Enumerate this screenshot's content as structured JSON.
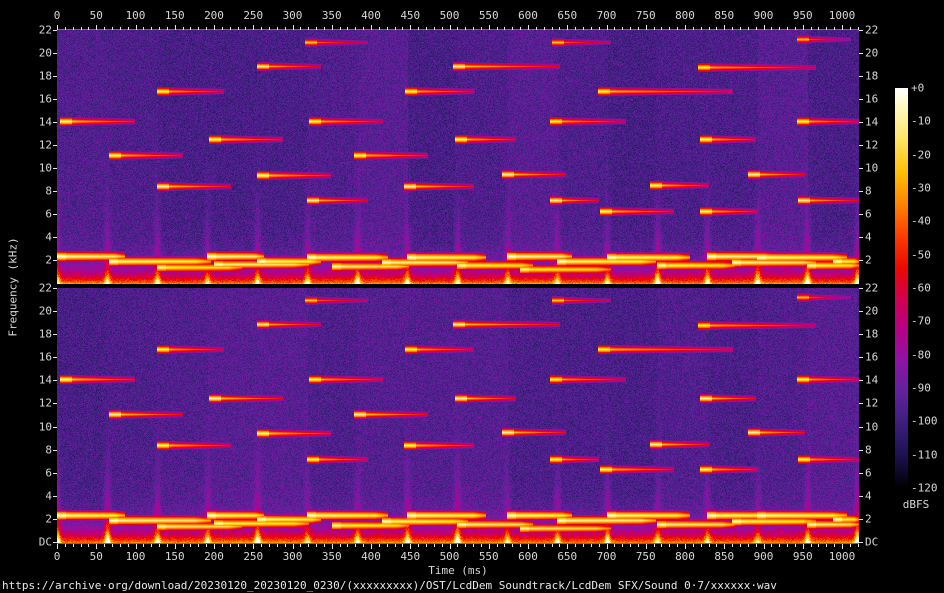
{
  "chart_data": {
    "type": "heatmap",
    "subtype": "stereo_audio_spectrogram",
    "title": "https://archive·org/download/20230120_20230120_0230/(xxxxxxxxx)/OST/LcdDem Soundtrack/LcdDem SFX/Sound 0·7/xxxxxx·wav",
    "xlabel": "Time (ms)",
    "ylabel": "Frequency (kHz)",
    "x_range_ms": [
      0,
      1022
    ],
    "x_ticks_ms": [
      0,
      50,
      100,
      150,
      200,
      250,
      300,
      350,
      400,
      450,
      500,
      550,
      600,
      650,
      700,
      750,
      800,
      850,
      900,
      950,
      1000
    ],
    "x_minor_tick_step_ms": 10,
    "y_range_khz": [
      0,
      22
    ],
    "y_tick_labels": [
      "22",
      "20",
      "18",
      "16",
      "14",
      "12",
      "10",
      "8",
      "6",
      "4",
      "2"
    ],
    "y_dc_label": "DC",
    "channels": [
      "channel-1",
      "channel-2"
    ],
    "legend_position": "right",
    "grid": false,
    "colorbar": {
      "label": "dBFS",
      "tick_labels": [
        "+0",
        "-10",
        "-20",
        "-30",
        "-40",
        "-50",
        "-60",
        "-70",
        "-80",
        "-90",
        "-100",
        "-110",
        "-120"
      ],
      "db_range": [
        0,
        -120
      ],
      "gradient_stops": [
        [
          0.0,
          "#ffffff"
        ],
        [
          0.04,
          "#fff9c8"
        ],
        [
          0.12,
          "#ffe76e"
        ],
        [
          0.21,
          "#ffc005"
        ],
        [
          0.29,
          "#ff8300"
        ],
        [
          0.37,
          "#ff3c00"
        ],
        [
          0.45,
          "#ec0800"
        ],
        [
          0.52,
          "#d4004a"
        ],
        [
          0.6,
          "#b80083"
        ],
        [
          0.68,
          "#8f13a5"
        ],
        [
          0.76,
          "#62219c"
        ],
        [
          0.84,
          "#3c1e7c"
        ],
        [
          0.92,
          "#1c1150"
        ],
        [
          1.0,
          "#000000"
        ]
      ]
    },
    "noise_floor_db": -96,
    "note_interval_ms": 63.7,
    "tone_segments": {
      "columns": [
        "t0_ms",
        "t1_ms",
        "khz",
        "level"
      ],
      "rows": [
        [
          4,
          98,
          14.1,
          0.95
        ],
        [
          66,
          159,
          11.1,
          0.9
        ],
        [
          127,
          212,
          16.7,
          0.85
        ],
        [
          127,
          220,
          8.4,
          0.9
        ],
        [
          194,
          287,
          12.5,
          0.9
        ],
        [
          255,
          335,
          18.9,
          0.8
        ],
        [
          255,
          348,
          9.4,
          0.95
        ],
        [
          316,
          395,
          21.0,
          0.55
        ],
        [
          318,
          395,
          7.2,
          0.85
        ],
        [
          321,
          414,
          14.1,
          0.85
        ],
        [
          378,
          471,
          11.1,
          0.9
        ],
        [
          443,
          530,
          16.7,
          0.85
        ],
        [
          442,
          530,
          8.4,
          0.9
        ],
        [
          505,
          639,
          18.9,
          0.85
        ],
        [
          507,
          583,
          12.5,
          0.9
        ],
        [
          567,
          647,
          9.5,
          0.9
        ],
        [
          628,
          723,
          14.1,
          0.8
        ],
        [
          628,
          689,
          7.2,
          0.85
        ],
        [
          631,
          704,
          21.0,
          0.55
        ],
        [
          689,
          860,
          16.7,
          0.85
        ],
        [
          692,
          785,
          6.3,
          0.9
        ],
        [
          755,
          829,
          8.5,
          0.9
        ],
        [
          817,
          966,
          18.8,
          0.8
        ],
        [
          819,
          889,
          12.5,
          0.9
        ],
        [
          819,
          892,
          6.3,
          0.9
        ],
        [
          880,
          952,
          9.5,
          0.9
        ],
        [
          943,
          1021,
          14.1,
          0.85
        ],
        [
          944,
          1021,
          7.2,
          0.85
        ],
        [
          943,
          1010,
          21.2,
          0.5
        ]
      ]
    },
    "bass_segments": {
      "columns": [
        "t0_ms",
        "t1_ms",
        "khz",
        "level"
      ],
      "rows": [
        [
          0,
          85,
          2.35,
          1
        ],
        [
          66,
          195,
          1.9,
          0.95
        ],
        [
          127,
          235,
          1.38,
          0.7
        ],
        [
          191,
          262,
          2.35,
          1
        ],
        [
          200,
          320,
          1.65,
          0.8
        ],
        [
          255,
          335,
          1.95,
          0.95
        ],
        [
          318,
          420,
          2.3,
          1
        ],
        [
          350,
          447,
          1.5,
          0.75
        ],
        [
          414,
          522,
          1.85,
          0.9
        ],
        [
          446,
          545,
          2.3,
          1
        ],
        [
          510,
          605,
          1.55,
          0.8
        ],
        [
          573,
          655,
          2.35,
          1
        ],
        [
          590,
          705,
          1.2,
          0.65
        ],
        [
          637,
          762,
          1.9,
          0.95
        ],
        [
          701,
          805,
          2.3,
          1
        ],
        [
          764,
          862,
          1.6,
          0.8
        ],
        [
          828,
          915,
          2.35,
          1
        ],
        [
          860,
          965,
          1.82,
          0.85
        ],
        [
          892,
          1005,
          2.3,
          1
        ],
        [
          955,
          1021,
          1.55,
          0.8
        ],
        [
          988,
          1021,
          1.95,
          0.85
        ]
      ]
    }
  }
}
